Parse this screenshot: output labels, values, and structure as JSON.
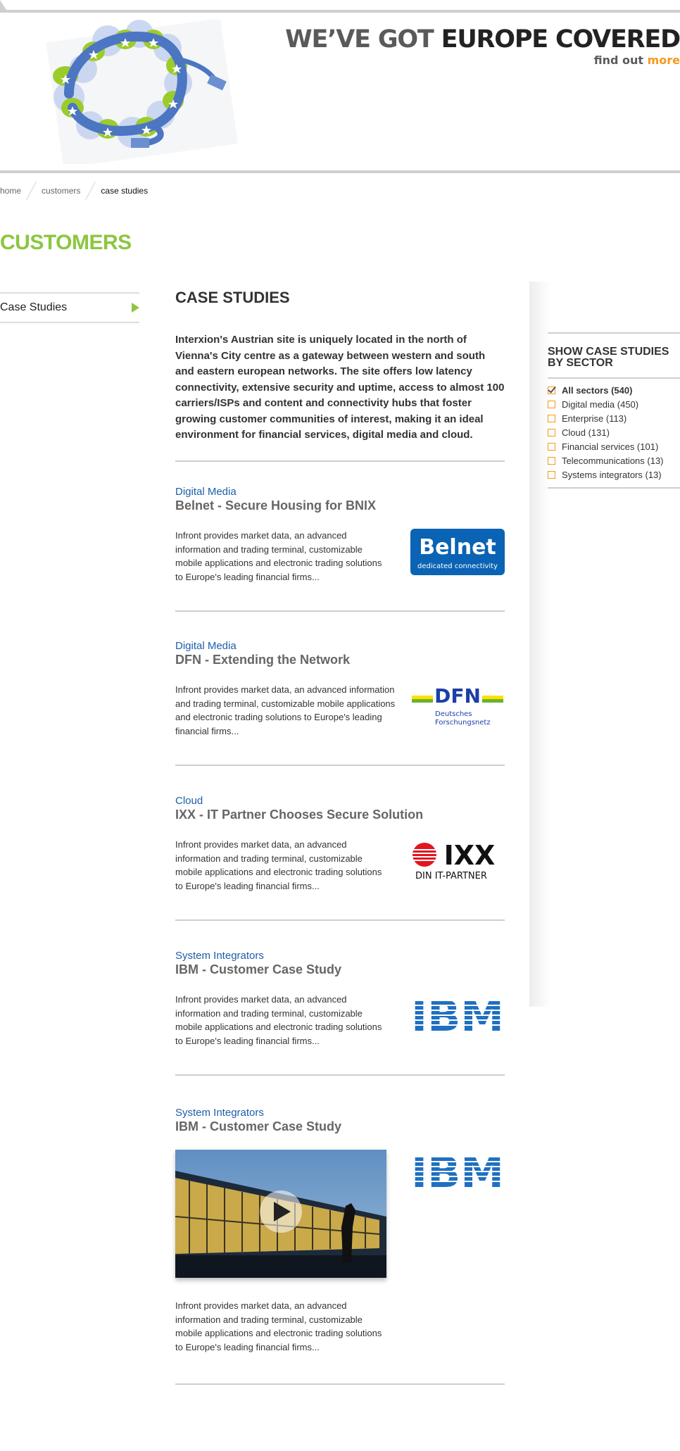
{
  "header": {
    "tagline_part1": "WE’VE GOT ",
    "tagline_part2": "EUROPE COVERED",
    "findout_text": "find out ",
    "findout_link": "more"
  },
  "breadcrumb": [
    "home",
    "customers",
    "case studies"
  ],
  "page_title": "CUSTOMERS",
  "left_nav": {
    "item": "Case Studies"
  },
  "content": {
    "heading": "CASE STUDIES",
    "intro": "Interxion's Austrian site is uniquely located in the north of Vienna's City centre as a gateway between western and south and eastern european networks. The site offers low latency connectivity, extensive security and uptime, access to almost 100 carriers/ISPs and content and connectivity hubs that foster growing customer communities of interest, making it an ideal environment for financial services, digital media and cloud."
  },
  "studies": [
    {
      "category": "Digital Media",
      "title": "Belnet - Secure Housing for BNIX",
      "desc": "Infront provides market data, an advanced information and trading terminal, customizable mobile applications and electronic trading solutions to Europe's leading financial firms...",
      "logo": "Belnet",
      "logo_sub": "dedicated connectivity"
    },
    {
      "category": "Digital Media",
      "title": "DFN - Extending the Network",
      "desc": "Infront provides market data, an advanced information and trading terminal, customizable mobile applications and electronic trading solutions to Europe's leading financial firms...",
      "logo": "DFN",
      "logo_sub1": "Deutsches",
      "logo_sub2": "Forschungsnetz"
    },
    {
      "category": "Cloud",
      "title": "IXX - IT Partner Chooses Secure Solution",
      "desc": "Infront provides market data, an advanced information and trading terminal, customizable mobile applications and electronic trading solutions to Europe's leading financial firms...",
      "logo": "IXX",
      "logo_sub": "DIN IT-PARTNER"
    },
    {
      "category": "System Integrators",
      "title": "IBM - Customer Case Study",
      "desc": "Infront provides market data, an advanced information and trading terminal, customizable mobile applications and electronic trading solutions to Europe's leading financial firms...",
      "logo": "IBM"
    },
    {
      "category": "System Integrators",
      "title": "IBM - Customer Case Study",
      "desc": "Infront provides market data, an advanced information and trading terminal, customizable mobile applications and electronic trading solutions to Europe's leading financial firms...",
      "logo": "IBM"
    }
  ],
  "sidebar": {
    "heading": "SHOW CASE STUDIES BY SECTOR",
    "filters": [
      {
        "label": "All sectors (540)",
        "checked": true
      },
      {
        "label": "Digital media (450)",
        "checked": false
      },
      {
        "label": "Enterprise (113)",
        "checked": false
      },
      {
        "label": "Cloud (131)",
        "checked": false
      },
      {
        "label": "Financial services (101)",
        "checked": false
      },
      {
        "label": "Telecommunications (13)",
        "checked": false
      },
      {
        "label": "Systems integrators (13)",
        "checked": false
      }
    ]
  },
  "colors": {
    "accent_green": "#8cc63f",
    "accent_orange": "#f39a1b",
    "link_blue": "#1d5ea8",
    "ibm_blue": "#1f70c1",
    "belnet_blue": "#0a63b4"
  }
}
